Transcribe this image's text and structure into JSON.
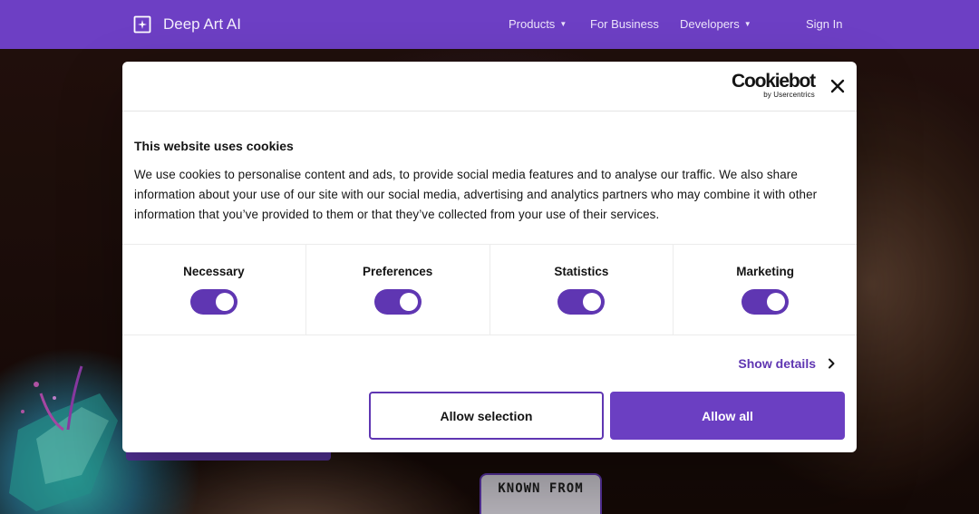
{
  "header": {
    "logo_text": "Deep Art AI",
    "nav": [
      {
        "label": "Products",
        "has_dropdown": true
      },
      {
        "label": "For Business",
        "has_dropdown": false
      },
      {
        "label": "Developers",
        "has_dropdown": true
      }
    ],
    "signin_label": "Sign In",
    "bg_color": "#6d3fc4"
  },
  "hero": {
    "known_from_label": "KNOWN FROM"
  },
  "cookie_dialog": {
    "brand_name": "Cookiebot",
    "brand_by": "by Usercentrics",
    "close_icon": "close-icon",
    "title": "This website uses cookies",
    "text": "We use cookies to personalise content and ads, to provide social media features and to analyse our traffic. We also share information about your use of our site with our social media, advertising and analytics partners who may combine it with other information that you’ve provided to them or that they’ve collected from your use of their services.",
    "categories": [
      {
        "label": "Necessary",
        "enabled": true
      },
      {
        "label": "Preferences",
        "enabled": true
      },
      {
        "label": "Statistics",
        "enabled": true
      },
      {
        "label": "Marketing",
        "enabled": true
      }
    ],
    "show_details_label": "Show details",
    "allow_selection_label": "Allow selection",
    "allow_all_label": "Allow all",
    "accent_color": "#5f36b2"
  }
}
